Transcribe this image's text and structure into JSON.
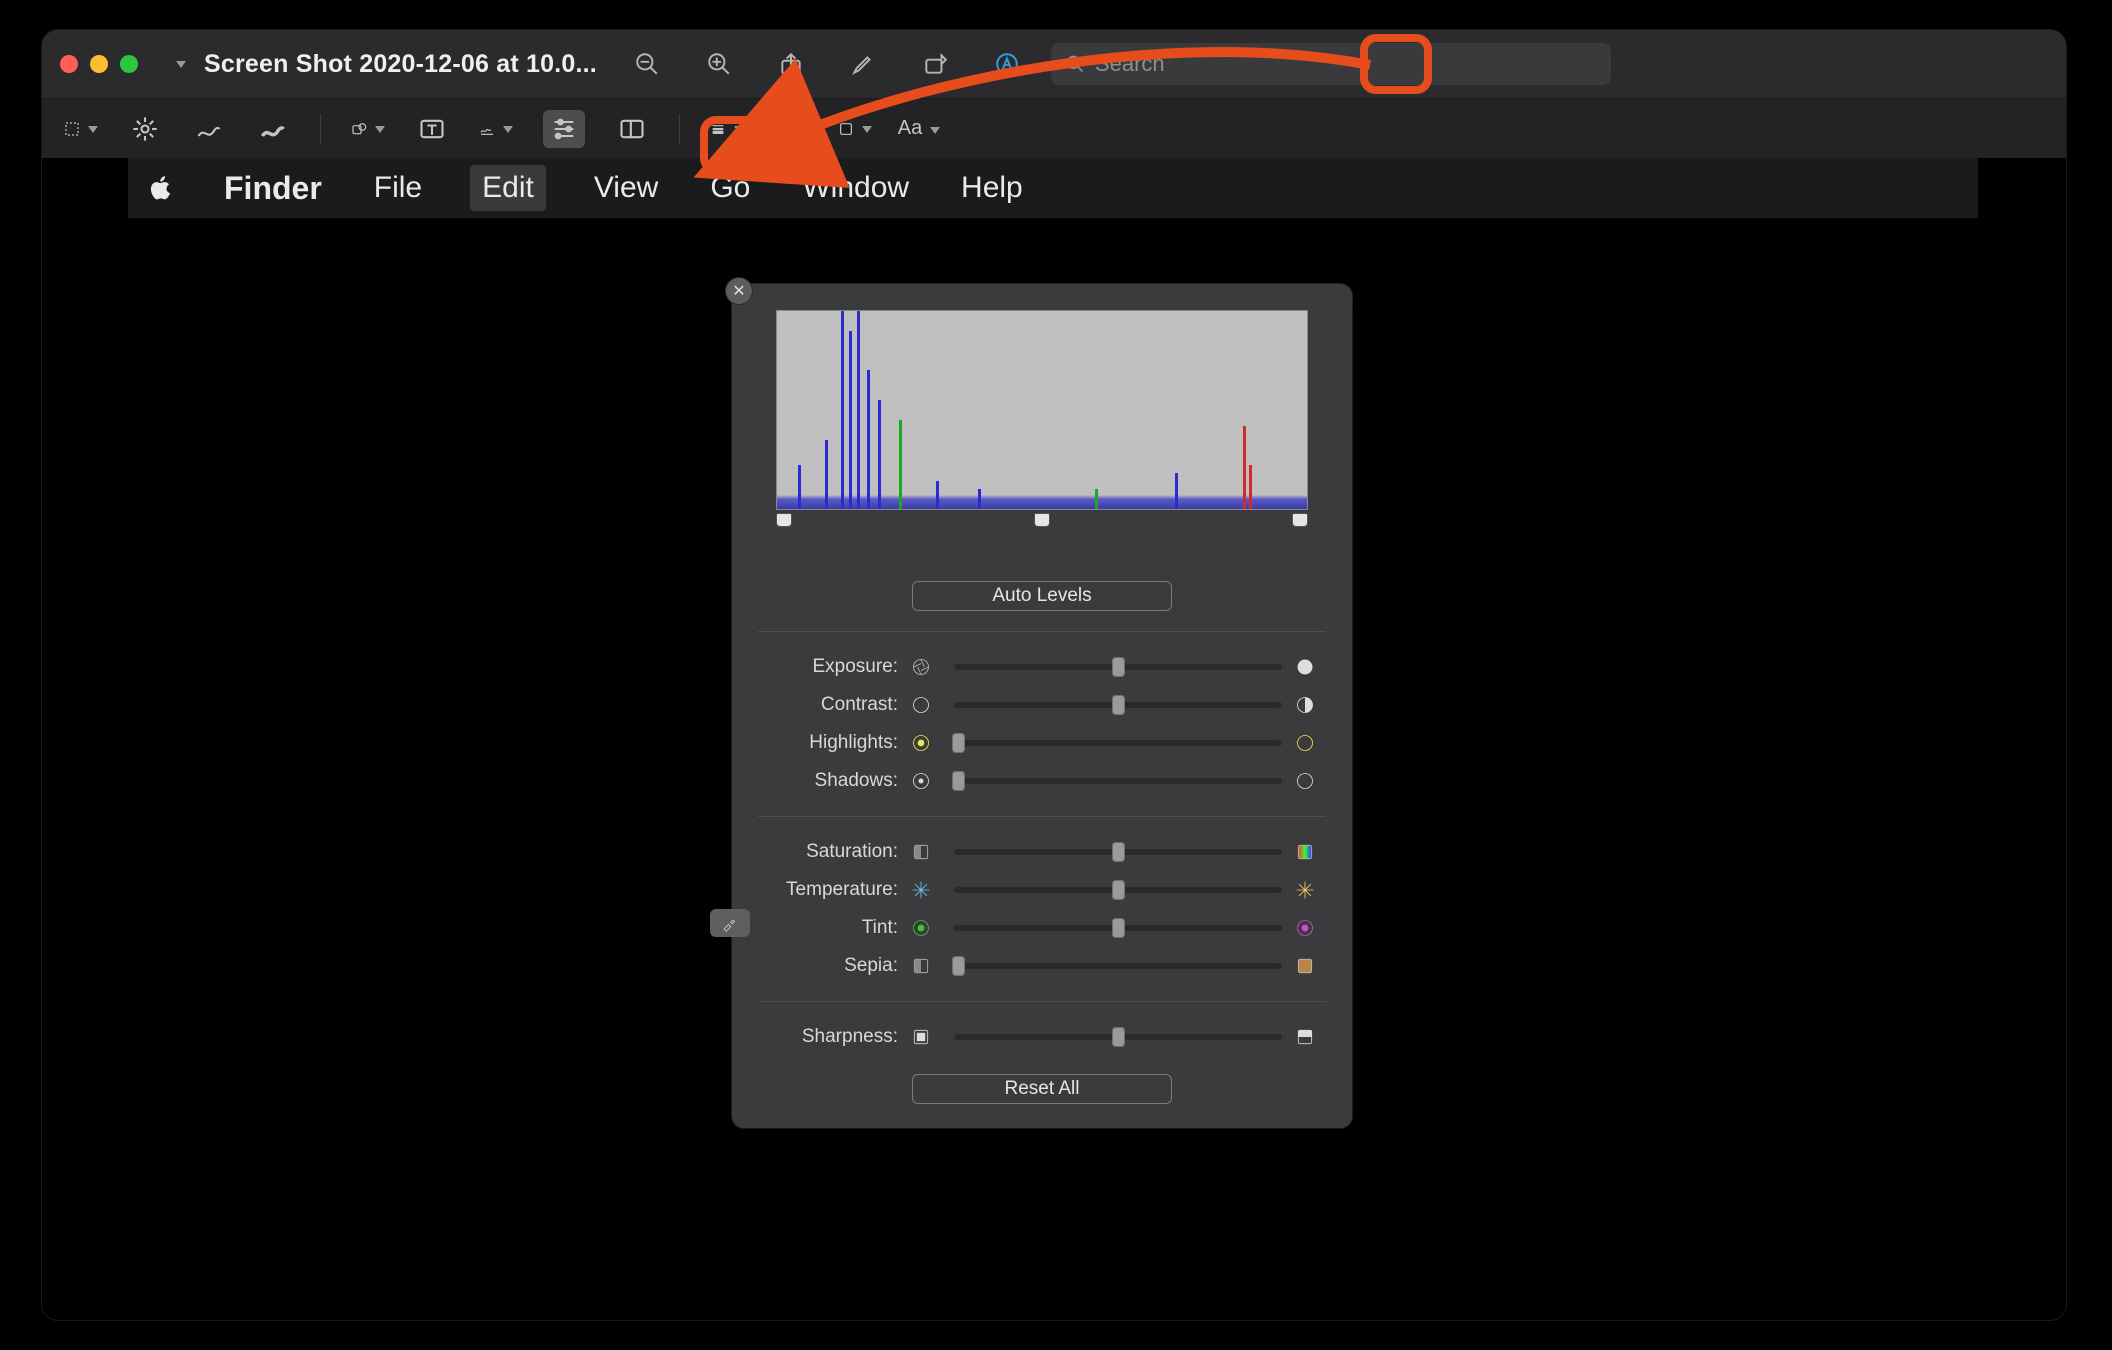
{
  "window": {
    "title": "Screen Shot 2020-12-06 at 10.0..."
  },
  "search": {
    "placeholder": "Search"
  },
  "menubar": {
    "app": "Finder",
    "items": [
      "File",
      "Edit",
      "View",
      "Go",
      "Window",
      "Help"
    ],
    "active": "Edit"
  },
  "popover": {
    "auto_levels": "Auto Levels",
    "reset_all": "Reset All",
    "sliders": {
      "exposure": {
        "label": "Exposure:",
        "pos": 50
      },
      "contrast": {
        "label": "Contrast:",
        "pos": 50
      },
      "highlights": {
        "label": "Highlights:",
        "pos": 0
      },
      "shadows": {
        "label": "Shadows:",
        "pos": 0
      },
      "saturation": {
        "label": "Saturation:",
        "pos": 50
      },
      "temperature": {
        "label": "Temperature:",
        "pos": 50
      },
      "tint": {
        "label": "Tint:",
        "pos": 50
      },
      "sepia": {
        "label": "Sepia:",
        "pos": 0
      },
      "sharpness": {
        "label": "Sharpness:",
        "pos": 50
      }
    },
    "histogram": {
      "handles": [
        0,
        50,
        100
      ]
    }
  },
  "annotation": {
    "color": "#e74c1c"
  }
}
